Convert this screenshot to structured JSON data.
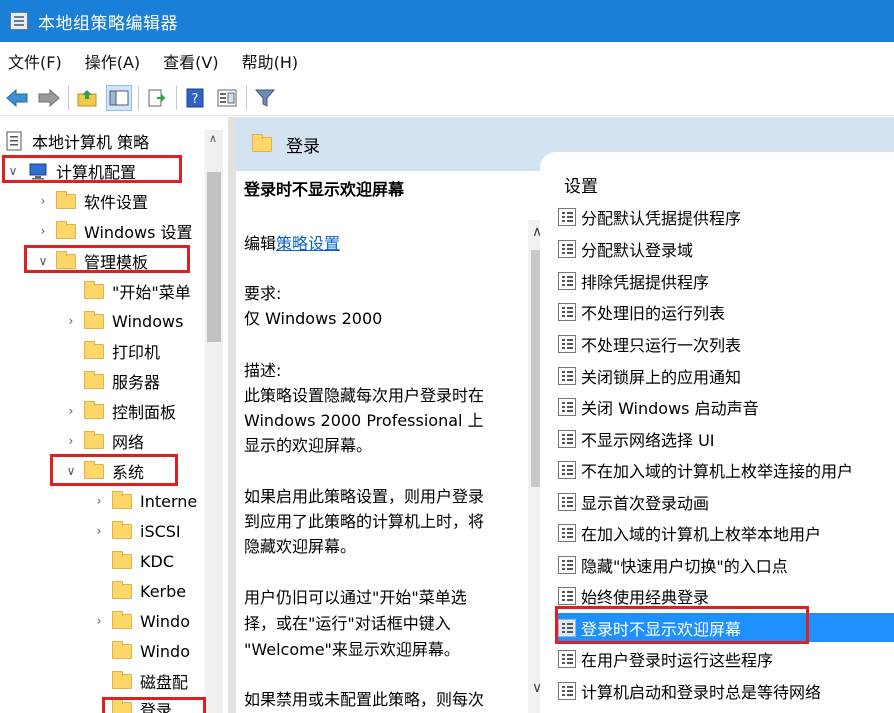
{
  "window": {
    "title": "本地组策略编辑器"
  },
  "menu": [
    "文件(F)",
    "操作(A)",
    "查看(V)",
    "帮助(H)"
  ],
  "tree": {
    "root": "本地计算机 策略",
    "computer_config": "计算机配置",
    "software_settings": "软件设置",
    "windows_settings": "Windows 设置",
    "admin_templates": "管理模板",
    "start_menu": "\"开始\"菜单",
    "windows_components": "Windows",
    "printers": "打印机",
    "server": "服务器",
    "control_panel": "控制面板",
    "network": "网络",
    "system": "系统",
    "internet": "Interne",
    "iscsi": "iSCSI",
    "kdc": "KDC",
    "kerberos": "Kerbe",
    "windows_a": "Windo",
    "windows_b": "Windo",
    "disk": "磁盘配",
    "logon": "登录"
  },
  "middle": {
    "header": "登录",
    "policy_title": "登录时不显示欢迎屏幕",
    "edit_prefix": "编辑",
    "edit_link": "策略设置",
    "requirements_label": "要求:",
    "requirements_value": "仅 Windows 2000",
    "description_label": "描述:",
    "desc_line1": "此策略设置隐藏每次用户登录时在",
    "desc_line2": "Windows 2000 Professional 上",
    "desc_line3": "显示的欢迎屏幕。",
    "p2_line1": "如果启用此策略设置，则用户登录",
    "p2_line2": "到应用了此策略的计算机上时，将",
    "p2_line3": "隐藏欢迎屏幕。",
    "p3_line1": "用户仍旧可以通过\"开始\"菜单选",
    "p3_line2": "择，或在\"运行\"对话框中键入",
    "p3_line3": "\"Welcome\"来显示欢迎屏幕。",
    "p4_line1": "如果禁用或未配置此策略，则每次"
  },
  "right": {
    "header": "设置",
    "items": [
      "分配默认凭据提供程序",
      "分配默认登录域",
      "排除凭据提供程序",
      "不处理旧的运行列表",
      "不处理只运行一次列表",
      "关闭锁屏上的应用通知",
      "关闭 Windows 启动声音",
      "不显示网络选择 UI",
      "不在加入域的计算机上枚举连接的用户",
      "显示首次登录动画",
      "在加入域的计算机上枚举本地用户",
      "隐藏\"快速用户切换\"的入口点",
      "始终使用经典登录",
      "登录时不显示欢迎屏幕",
      "在用户登录时运行这些程序",
      "计算机启动和登录时总是等待网络"
    ]
  },
  "colors": {
    "titlebar": "#1a7fd6",
    "selection": "#1e90ff",
    "highlight": "#e02020",
    "header_band": "#d3e3f1"
  }
}
